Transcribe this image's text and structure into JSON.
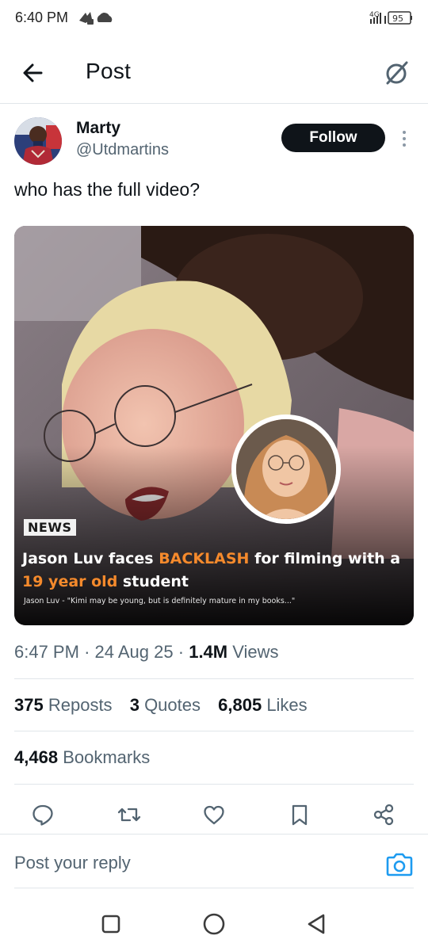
{
  "status_bar": {
    "time": "6:40 PM",
    "network": "4G",
    "battery": "95"
  },
  "header": {
    "title": "Post"
  },
  "post": {
    "author_name": "Marty",
    "author_handle": "@Utdmartins",
    "follow_label": "Follow",
    "text": "who has the full video?",
    "media": {
      "tag": "NEWS",
      "headline_part1": "Jason Luv faces ",
      "headline_highlight1": "BACKLASH",
      "headline_part2": " for filming with a ",
      "headline_highlight2": "19 year old",
      "headline_part3": " student",
      "caption": "Jason Luv - \"Kimi may be young, but is definitely mature in my books...\""
    },
    "time": "6:47 PM",
    "date": "24 Aug 25",
    "views_count": "1.4M",
    "views_label": "Views",
    "reposts_count": "375",
    "reposts_label": "Reposts",
    "quotes_count": "3",
    "quotes_label": "Quotes",
    "likes_count": "6,805",
    "likes_label": "Likes",
    "bookmarks_count": "4,468",
    "bookmarks_label": "Bookmarks"
  },
  "actions": {
    "icons": [
      "reply-icon",
      "repost-icon",
      "like-icon",
      "bookmark-icon",
      "share-icon"
    ]
  },
  "reply": {
    "placeholder": "Post your reply"
  },
  "colors": {
    "accent": "#1d9bf0",
    "text_primary": "#0f1419",
    "text_secondary": "#536471",
    "highlight": "#f58a2c"
  }
}
